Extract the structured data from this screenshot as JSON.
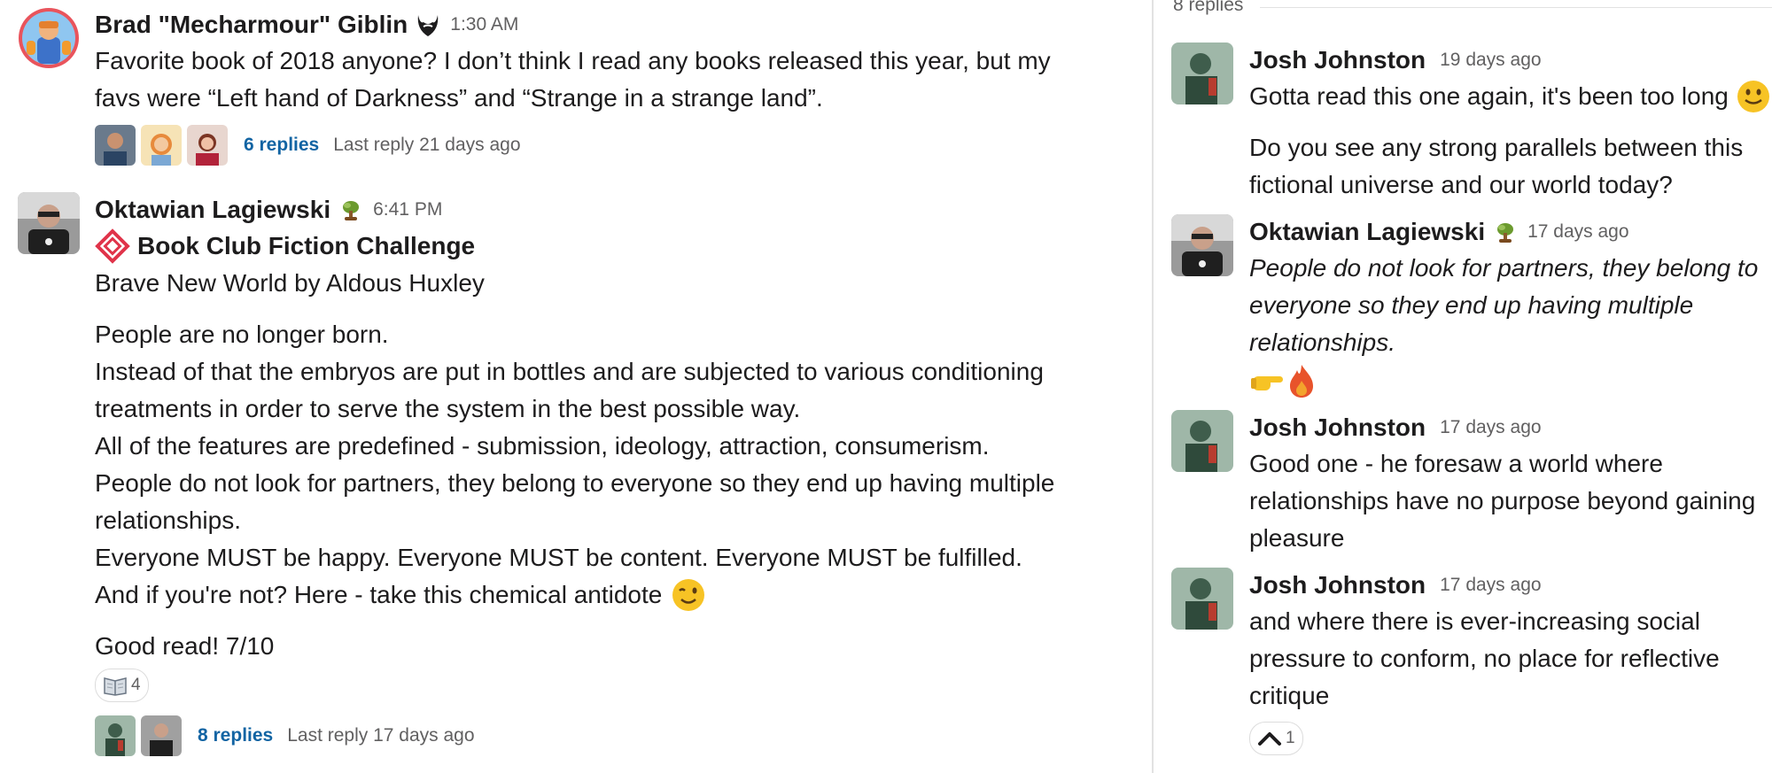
{
  "main": {
    "messages": [
      {
        "author": "Brad \"Mecharmour\" Giblin",
        "time": "1:30 AM",
        "lines": [
          "Favorite book of 2018 anyone? I don’t think I read any books released this year, but my",
          "favs were “Left hand of Darkness” and “Strange in a strange land”."
        ],
        "replies": "6 replies",
        "last_reply": "Last reply 21 days ago"
      },
      {
        "author": "Oktawian Lagiewski",
        "time": "6:41 PM",
        "title": "Book Club Fiction Challenge",
        "subtitle": "Brave New World by Aldous Huxley",
        "paragraph": [
          "People are no longer born.",
          "Instead of that the embryos are put in bottles and are subjected to various conditioning",
          "treatments in order to serve the system in the best possible way.",
          "All of the features are predefined - submission, ideology, attraction, consumerism.",
          "People do not look for partners, they belong to everyone so they end up having multiple",
          "relationships.",
          "Everyone MUST be happy. Everyone MUST be content. Everyone MUST be fulfilled.",
          "And if you're not? Here - take this chemical antidote"
        ],
        "closing": "Good read! 7/10",
        "reaction_count": "4",
        "replies": "8 replies",
        "last_reply": "Last reply 17 days ago"
      }
    ]
  },
  "thread": {
    "reply_count": "8 replies",
    "messages": [
      {
        "author": "Josh Johnston",
        "time": "19 days ago",
        "lines": [
          "Gotta read this one again, it's been too long"
        ],
        "extra": [
          "Do you see any strong parallels between this",
          "fictional universe and our world today?"
        ]
      },
      {
        "author": "Oktawian Lagiewski",
        "time": "17 days ago",
        "lines": [
          "People do not look for partners, they belong to",
          "everyone so they end up having multiple",
          "relationships."
        ]
      },
      {
        "author": "Josh Johnston",
        "time": "17 days ago",
        "lines": [
          "Good one - he foresaw a world where",
          "relationships have no purpose beyond gaining",
          "pleasure"
        ]
      },
      {
        "author": "Josh Johnston",
        "time": "17 days ago",
        "lines": [
          "and where there is ever-increasing social",
          "pressure to conform, no place for reflective",
          "critique"
        ],
        "reaction_count": "1"
      }
    ]
  },
  "colors": {
    "link": "#1264a3",
    "muted": "#616061",
    "text": "#1d1c1d"
  },
  "icons": [
    "beard-icon",
    "sapling-icon",
    "diamond-logo-icon",
    "wink-emoji",
    "book-emoji",
    "smile-emoji",
    "point-right-emoji",
    "fire-emoji",
    "caret-up-icon"
  ]
}
